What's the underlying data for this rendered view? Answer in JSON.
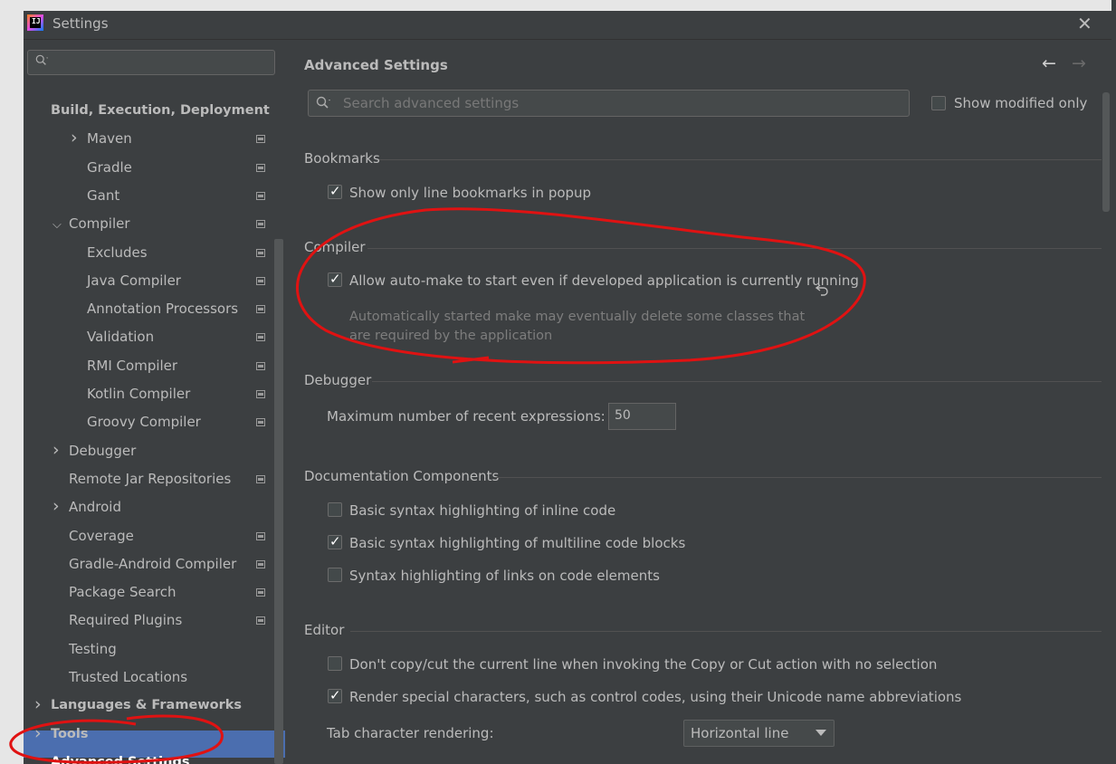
{
  "window": {
    "title": "Settings",
    "app_icon": "intellij-idea-icon",
    "close_icon": "close-icon"
  },
  "sidebar": {
    "search": {
      "placeholder": "",
      "icon": "search-icon"
    },
    "items": [
      {
        "label": "Build, Execution, Deployment",
        "level": 0,
        "bold": true
      },
      {
        "label": "Maven",
        "level": 2,
        "expandable": true,
        "project_icon": true
      },
      {
        "label": "Gradle",
        "level": 2,
        "project_icon": true
      },
      {
        "label": "Gant",
        "level": 2,
        "project_icon": true
      },
      {
        "label": "Compiler",
        "level": 1,
        "expanded": true,
        "project_icon": true
      },
      {
        "label": "Excludes",
        "level": 2,
        "project_icon": true
      },
      {
        "label": "Java Compiler",
        "level": 2,
        "project_icon": true
      },
      {
        "label": "Annotation Processors",
        "level": 2,
        "project_icon": true
      },
      {
        "label": "Validation",
        "level": 2,
        "project_icon": true
      },
      {
        "label": "RMI Compiler",
        "level": 2,
        "project_icon": true
      },
      {
        "label": "Kotlin Compiler",
        "level": 2,
        "project_icon": true
      },
      {
        "label": "Groovy Compiler",
        "level": 2,
        "project_icon": true
      },
      {
        "label": "Debugger",
        "level": 1,
        "expandable": true
      },
      {
        "label": "Remote Jar Repositories",
        "level": 1,
        "project_icon": true
      },
      {
        "label": "Android",
        "level": 1,
        "expandable": true
      },
      {
        "label": "Coverage",
        "level": 1,
        "project_icon": true
      },
      {
        "label": "Gradle-Android Compiler",
        "level": 1,
        "project_icon": true
      },
      {
        "label": "Package Search",
        "level": 1,
        "project_icon": true
      },
      {
        "label": "Required Plugins",
        "level": 1,
        "project_icon": true
      },
      {
        "label": "Testing",
        "level": 1
      },
      {
        "label": "Trusted Locations",
        "level": 1
      },
      {
        "label": "Languages & Frameworks",
        "level": 0,
        "bold": true,
        "expandable": true
      },
      {
        "label": "Tools",
        "level": 0,
        "bold": true,
        "expandable": true
      },
      {
        "label": "Advanced Settings",
        "level": 0,
        "bold": true,
        "selected": true
      }
    ]
  },
  "main": {
    "title": "Advanced Settings",
    "nav": {
      "back_icon": "arrow-left-icon",
      "forward_icon": "arrow-right-icon"
    },
    "search": {
      "placeholder": "Search advanced settings"
    },
    "show_modified_only": {
      "label": "Show modified only",
      "checked": false
    },
    "sections": {
      "bookmarks": {
        "title": "Bookmarks",
        "options": [
          {
            "label": "Show only line bookmarks in popup",
            "checked": true
          }
        ]
      },
      "compiler": {
        "title": "Compiler",
        "options": [
          {
            "label": "Allow auto-make to start even if developed application is currently running",
            "checked": true
          }
        ],
        "hint_line1": "Automatically started make may eventually delete some classes that",
        "hint_line2": "are required by the application",
        "reset_icon": "undo-icon"
      },
      "debugger": {
        "title": "Debugger",
        "max_expr_label": "Maximum number of recent expressions:",
        "max_expr_value": "50"
      },
      "documentation": {
        "title": "Documentation Components",
        "options": [
          {
            "label": "Basic syntax highlighting of inline code",
            "checked": false
          },
          {
            "label": "Basic syntax highlighting of multiline code blocks",
            "checked": true
          },
          {
            "label": "Syntax highlighting of links on code elements",
            "checked": false
          }
        ]
      },
      "editor": {
        "title": "Editor",
        "options": [
          {
            "label": "Don't copy/cut the current line when invoking the Copy or Cut action with no selection",
            "checked": false
          },
          {
            "label": "Render special characters, such as control codes, using their Unicode name abbreviations",
            "checked": true
          }
        ],
        "tab_rendering_label": "Tab character rendering:",
        "tab_rendering_value": "Horizontal line"
      }
    }
  },
  "colors": {
    "background": "#3c3f41",
    "text": "#bbbbbb",
    "selection": "#4b6eaf",
    "annotation": "#e01212"
  }
}
